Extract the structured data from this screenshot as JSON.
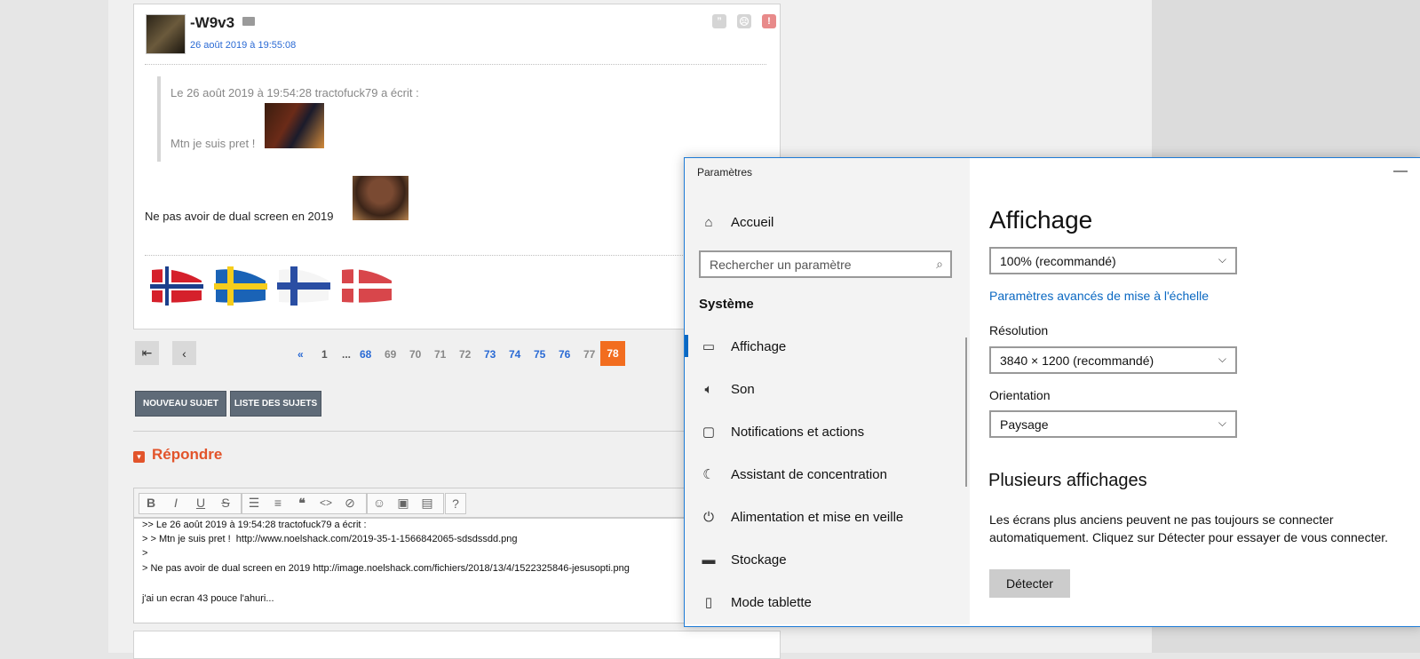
{
  "post": {
    "username": "-W9v3",
    "date": "26 août 2019 à 19:55:08",
    "quote_header": "Le 26 août 2019 à 19:54:28 tractofuck79 a écrit :",
    "quote_text": "Mtn je suis pret !",
    "body_text": "Ne pas avoir de dual screen en 2019"
  },
  "pagination": {
    "first_icon": "first-page-icon",
    "prev_icon": "prev-page-icon",
    "first_link": "«",
    "pages": [
      "1",
      "...",
      "68",
      "69",
      "70",
      "71",
      "72",
      "73",
      "74",
      "75",
      "76",
      "77"
    ],
    "current": "78"
  },
  "buttons": {
    "new_topic": "NOUVEAU SUJET",
    "topic_list": "LISTE DES SUJETS"
  },
  "reply": {
    "title": "Répondre"
  },
  "editor": {
    "lines": [
      ">> Le 26 août 2019 à 19:54:28 tractofuck79 a écrit :",
      "> > Mtn je suis pret !  http://www.noelshack.com/2019-35-1-1566842065-sdsdssdd.png",
      "> ",
      "> Ne pas avoir de dual screen en 2019 http://image.noelshack.com/fichiers/2018/13/4/1522325846-jesusopti.png",
      "",
      "j'ai un ecran 43 pouce l'ahuri..."
    ]
  },
  "settings": {
    "window_title": "Paramètres",
    "minimize": "—",
    "home": "Accueil",
    "search_placeholder": "Rechercher un paramètre",
    "section": "Système",
    "nav": [
      "Affichage",
      "Son",
      "Notifications et actions",
      "Assistant de concentration",
      "Alimentation et mise en veille",
      "Stockage",
      "Mode tablette"
    ],
    "page_title": "Affichage",
    "scale_value": "100% (recommandé)",
    "scale_link": "Paramètres avancés de mise à l'échelle",
    "resolution_label": "Résolution",
    "resolution_value": "3840 × 1200 (recommandé)",
    "orientation_label": "Orientation",
    "orientation_value": "Paysage",
    "multi_title": "Plusieurs affichages",
    "multi_text": "Les écrans plus anciens peuvent ne pas toujours se connecter automatiquement. Cliquez sur Détecter pour essayer de vous connecter.",
    "detect_button": "Détecter"
  },
  "colors": {
    "accent_blue": "#0a68c2",
    "forum_orange": "#f26d1f",
    "reply_red": "#e2542b",
    "link_blue": "#2a6ad4"
  }
}
